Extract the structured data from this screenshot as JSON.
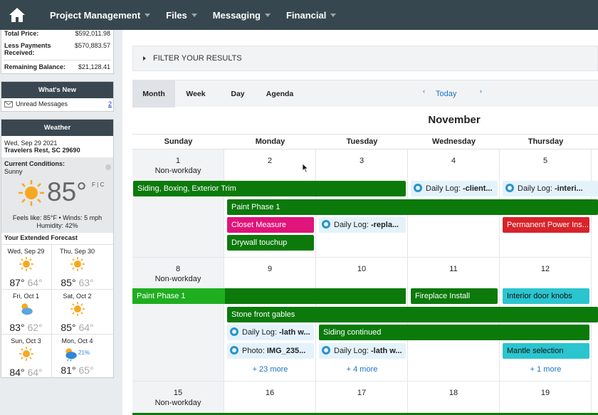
{
  "nav": {
    "home_icon": "home-icon",
    "items": [
      {
        "label": "Project Management"
      },
      {
        "label": "Files"
      },
      {
        "label": "Messaging"
      },
      {
        "label": "Financial"
      }
    ]
  },
  "sidebar": {
    "totals": [
      {
        "label": "Total Price:",
        "value": "$592,011.98"
      },
      {
        "label": "Less Payments Received:",
        "value": "$570,883.57"
      },
      {
        "label": "Remaining Balance:",
        "value": "$21,128.41"
      }
    ],
    "whats_new": {
      "title": "What's New",
      "unread_label": "Unread Messages",
      "unread_count": "2"
    },
    "weather": {
      "title": "Weather",
      "date": "Wed, Sep 29 2021",
      "location": "Travelers Rest, SC 29690",
      "conditions_label": "Current Conditions:",
      "conditions": "Sunny",
      "temp": "85°",
      "unit_f": "F",
      "unit_sep": "|",
      "unit_c": "C",
      "feels": "Feels like: 85°F • Winds: 5 mph",
      "humidity": "Humidity: 42%",
      "forecast_title": "Your Extended Forecast",
      "forecast": [
        {
          "date": "Wed, Sep 29",
          "hi": "87°",
          "lo": "64°",
          "icon": "sun-icon"
        },
        {
          "date": "Thu, Sep 30",
          "hi": "85°",
          "lo": "63°",
          "icon": "sun-icon"
        },
        {
          "date": "Fri, Oct 1",
          "hi": "83°",
          "lo": "62°",
          "icon": "partly-cloudy-icon"
        },
        {
          "date": "Sat, Oct 2",
          "hi": "85°",
          "lo": "64°",
          "icon": "sun-icon"
        },
        {
          "date": "Sun, Oct 3",
          "hi": "84°",
          "lo": "64°",
          "icon": "sun-icon"
        },
        {
          "date": "Mon, Oct 4",
          "hi": "81°",
          "lo": "65°",
          "icon": "rain-icon",
          "precip": "21%"
        }
      ]
    }
  },
  "filter": {
    "label": "FILTER YOUR RESULTS"
  },
  "calendar": {
    "views": [
      "Month",
      "Week",
      "Day",
      "Agenda"
    ],
    "active_view": "Month",
    "prev": "‹",
    "next": "›",
    "today": "Today",
    "month_title": "November",
    "dow": [
      "Sunday",
      "Monday",
      "Tuesday",
      "Wednesday",
      "Thursday"
    ],
    "nonworkday_label": "Non-workday",
    "weeks": [
      {
        "days": [
          "1",
          "2",
          "3",
          "4",
          "5"
        ]
      },
      {
        "days": [
          "8",
          "9",
          "10",
          "11",
          "12"
        ]
      },
      {
        "days": [
          "15",
          "16",
          "17",
          "18",
          "19"
        ]
      }
    ],
    "events": {
      "siding_boxing": "Siding, Boxing, Exterior Trim",
      "log_client_prefix": "Daily Log: ",
      "log_client_bold": "-client...",
      "log_interi_prefix": "Daily Log: ",
      "log_interi_bold": "-interi...",
      "paint_phase_1": "Paint Phase 1",
      "closet_measure": "Closet Measure",
      "log_repla_prefix": "Daily Log: ",
      "log_repla_bold": "-repla...",
      "permanent_power": "Permanent Power Ins...",
      "drywall_touchup": "Drywall touchup",
      "paint_phase_1_w2": "Paint Phase 1",
      "fireplace_install": "Fireplace Install",
      "interior_door_knobs": "Interior door knobs",
      "stone_front_gables": "Stone front gables",
      "log_lath_prefix": "Daily Log: ",
      "log_lath_bold": "-lath w...",
      "siding_continued": "Siding continued",
      "photo_prefix": "Photo: ",
      "photo_bold": "IMG_235...",
      "log_lath2_prefix": "Daily Log: ",
      "log_lath2_bold": "-lath w...",
      "mantle_selection": "Mantle selection",
      "more_mon": "+ 23 more",
      "more_tue": "+ 4 more",
      "more_thu": "+ 1 more"
    }
  }
}
